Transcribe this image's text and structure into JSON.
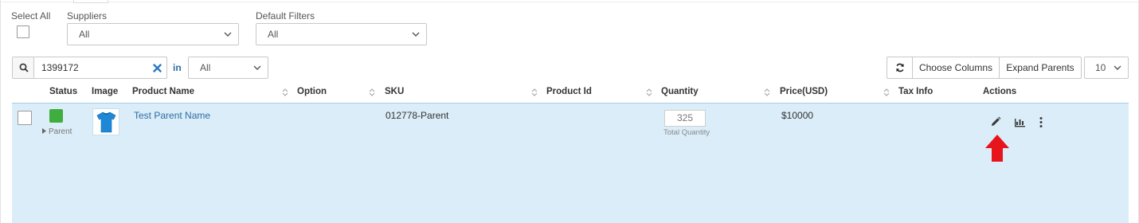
{
  "filters": {
    "select_all_label": "Select All",
    "suppliers_label": "Suppliers",
    "suppliers_value": "All",
    "default_filters_label": "Default Filters",
    "default_filters_value": "All"
  },
  "search": {
    "value": "1399172",
    "in_label": "in",
    "scope_value": "All"
  },
  "toolbar": {
    "choose_columns": "Choose Columns",
    "expand_parents": "Expand Parents",
    "page_size": "10"
  },
  "table": {
    "headers": {
      "status": "Status",
      "image": "Image",
      "product_name": "Product Name",
      "option": "Option",
      "sku": "SKU",
      "product_id": "Product Id",
      "quantity": "Quantity",
      "price": "Price(USD)",
      "tax_info": "Tax Info",
      "actions": "Actions"
    },
    "rows": [
      {
        "status_color": "#3fae3f",
        "type_label": "Parent",
        "product_name": "Test Parent Name",
        "sku": "012778-Parent",
        "quantity": "325",
        "quantity_caption": "Total Quantity",
        "price": "$10000",
        "image_icon": "tshirt-icon"
      }
    ]
  },
  "colors": {
    "row_highlight": "#dbedf9",
    "link": "#2e6da4",
    "clear_icon": "#2b78c2",
    "annotation_arrow": "#e8141b"
  }
}
